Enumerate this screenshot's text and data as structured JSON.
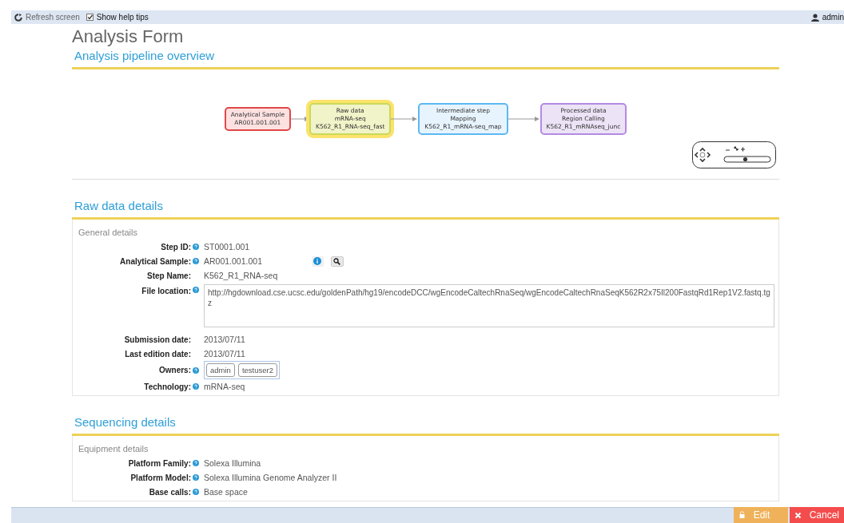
{
  "toolbar": {
    "refresh": "Refresh screen",
    "help_tips": {
      "label": "Show help tips",
      "checked": true
    },
    "user": "admin"
  },
  "title": "Analysis Form",
  "pipeline": {
    "heading": "Analysis pipeline overview",
    "nodes": [
      {
        "lines": [
          "Analytical Sample",
          "AR001.001.001"
        ],
        "color": "#e04848",
        "selected": false
      },
      {
        "lines": [
          "Raw data",
          "mRNA-seq",
          "K562_R1_RNA-seq_fast"
        ],
        "color": "#c9d95a",
        "selected": true
      },
      {
        "lines": [
          "Intermediate step",
          "Mapping",
          "K562_R1_mRNA-seq_map"
        ],
        "color": "#5cb8f2",
        "selected": false
      },
      {
        "lines": [
          "Processed data",
          "Region Calling",
          "K562_R1_mRNAseq_junc"
        ],
        "color": "#b48ae2",
        "selected": false
      }
    ],
    "zoom": {
      "level": 0.45
    }
  },
  "sections": [
    {
      "heading": "Raw data details",
      "group": "General details",
      "fields": [
        {
          "kind": "text",
          "label": "Step ID:",
          "help": true,
          "value": "ST0001.001"
        },
        {
          "kind": "lookup",
          "label": "Analytical Sample:",
          "help": true,
          "value": "AR001.001.001"
        },
        {
          "kind": "text",
          "label": "Step Name:",
          "help": false,
          "value": "K562_R1_RNA-seq"
        },
        {
          "kind": "textarea",
          "label": "File location:",
          "help": true,
          "value": "http://hgdownload.cse.ucsc.edu/goldenPath/hg19/encodeDCC/wgEncodeCaltechRnaSeq/wgEncodeCaltechRnaSeqK562R2x75Il200FastqRd1Rep1V2.fastq.tgz"
        },
        {
          "kind": "text",
          "label": "Submission date:",
          "help": false,
          "value": "2013/07/11"
        },
        {
          "kind": "text",
          "label": "Last edition date:",
          "help": false,
          "value": "2013/07/11"
        },
        {
          "kind": "tags",
          "label": "Owners:",
          "help": true,
          "tags": [
            "admin",
            "testuser2"
          ]
        },
        {
          "kind": "text",
          "label": "Technology:",
          "help": true,
          "value": "mRNA-seq"
        }
      ]
    },
    {
      "heading": "Sequencing details",
      "group": "Equipment details",
      "fields": [
        {
          "kind": "text",
          "label": "Platform Family:",
          "help": true,
          "value": "Solexa Illumina"
        },
        {
          "kind": "text",
          "label": "Platform Model:",
          "help": true,
          "value": "Solexa Illumina Genome Analyzer II"
        },
        {
          "kind": "text",
          "label": "Base calls:",
          "help": true,
          "value": "Base space"
        }
      ]
    }
  ],
  "actions": [
    {
      "kind": "edit",
      "label": "Edit"
    },
    {
      "kind": "cancel",
      "label": "Cancel"
    }
  ]
}
